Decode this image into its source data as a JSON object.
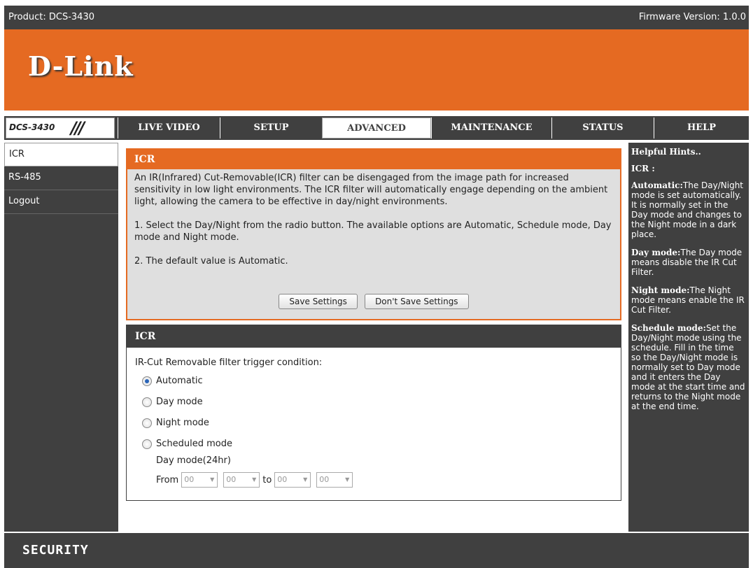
{
  "header": {
    "product": "Product: DCS-3430",
    "firmware": "Firmware Version: 1.0.0",
    "logo": "D-Link"
  },
  "nav": {
    "model": "DCS-3430",
    "model_mark": "///",
    "tabs": [
      {
        "label": "LIVE VIDEO"
      },
      {
        "label": "SETUP"
      },
      {
        "label": "ADVANCED",
        "active": true
      },
      {
        "label": "MAINTENANCE"
      },
      {
        "label": "STATUS"
      },
      {
        "label": "HELP"
      }
    ]
  },
  "sidebar": {
    "items": [
      {
        "label": "ICR",
        "active": true
      },
      {
        "label": "RS-485"
      },
      {
        "label": "Logout"
      }
    ]
  },
  "info": {
    "title": "ICR",
    "p1": "An IR(Infrared) Cut-Removable(ICR) filter can be disengaged from the image path for increased sensitivity in low light environments. The ICR filter will automatically engage depending on the ambient light, allowing the camera to be effective in day/night environments.",
    "p2": "1. Select the Day/Night from the radio button. The available options are Automatic, Schedule mode, Day mode and Night mode.",
    "p3": "2. The default value is Automatic.",
    "save_label": "Save Settings",
    "dont_save_label": "Don't Save Settings"
  },
  "icr": {
    "title": "ICR",
    "condition_label": "IR-Cut Removable filter trigger condition:",
    "options": [
      {
        "label": "Automatic",
        "checked": true
      },
      {
        "label": "Day mode",
        "checked": false
      },
      {
        "label": "Night mode",
        "checked": false
      },
      {
        "label": "Scheduled mode",
        "checked": false
      }
    ],
    "daymode_label": "Day mode(24hr)",
    "from_label": "From",
    "to_label": "to",
    "from_hour": "00",
    "from_min": "00",
    "to_hour": "00",
    "to_min": "00"
  },
  "help": {
    "title": "Helpful Hints..",
    "section": "ICR :",
    "items": [
      {
        "term": "Automatic:",
        "text": "The Day/Night mode is set automatically. It is normally set in the Day mode and changes to the Night mode in a dark place."
      },
      {
        "term": "Day mode:",
        "text": "The Day mode means disable the IR Cut Filter."
      },
      {
        "term": "Night mode:",
        "text": "The Night mode means enable the IR Cut Filter."
      },
      {
        "term": "Schedule mode:",
        "text": "Set the Day/Night mode using the schedule. Fill in the time so the Day/Night mode is normally set to Day mode and it enters the Day mode at the start time and returns to the Night mode at the end time."
      }
    ]
  },
  "footer": {
    "label": "SECURITY"
  },
  "colors": {
    "accent": "#e56a22",
    "dark": "#404040"
  }
}
